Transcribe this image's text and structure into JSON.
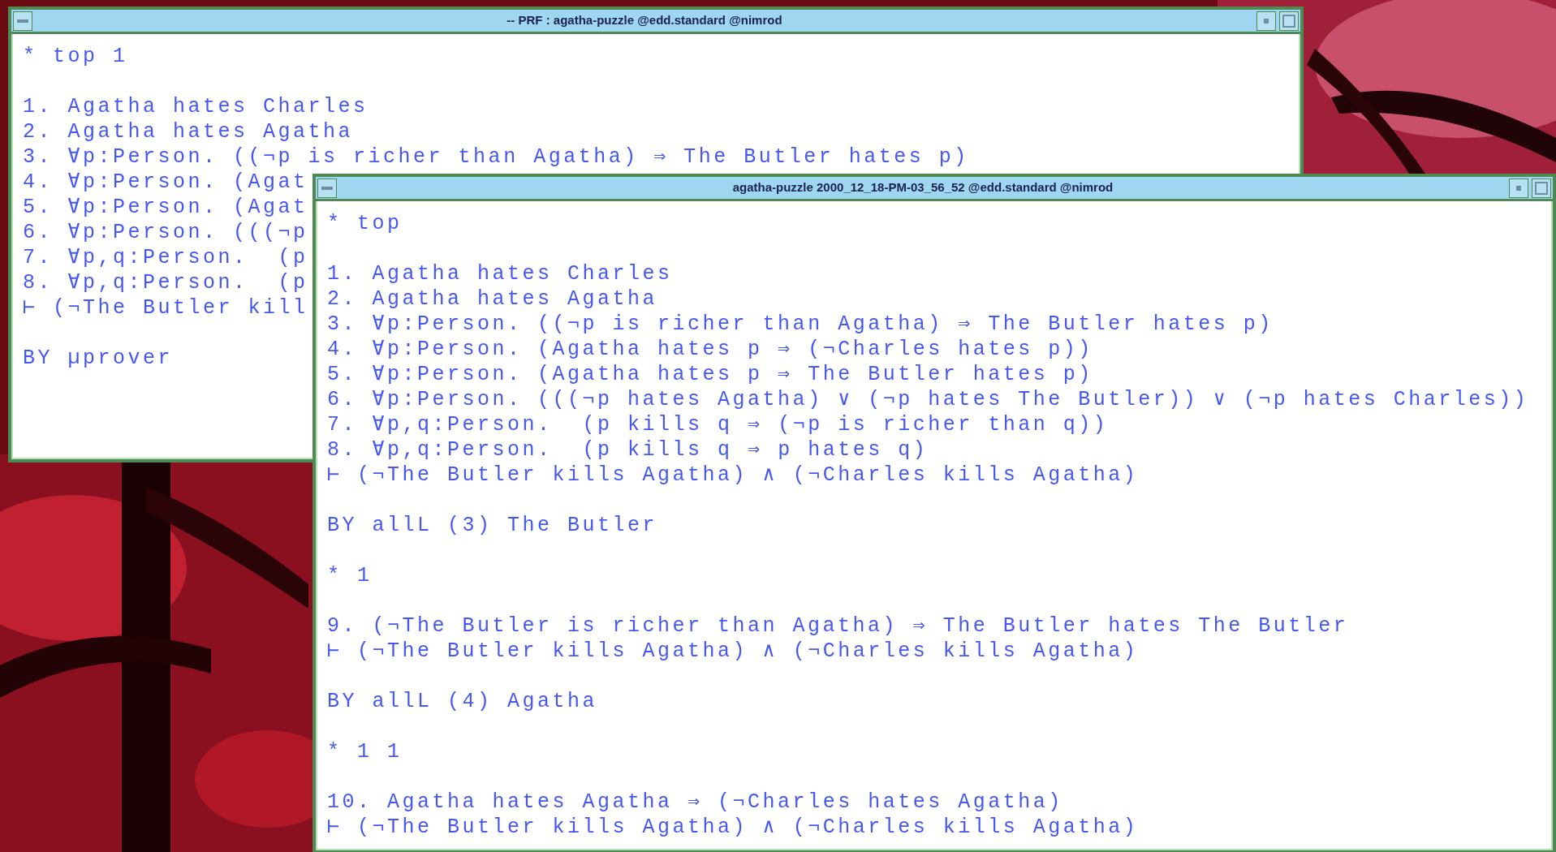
{
  "windows": [
    {
      "title": "-- PRF : agatha-puzzle @edd.standard @nimrod",
      "blocks": [
        [
          "* top 1"
        ],
        [
          "1. Agatha hates Charles",
          "2. Agatha hates Agatha",
          "3. ∀p:Person. ((¬p is richer than Agatha) ⇒ The Butler hates p)",
          "4. ∀p:Person. (Agat",
          "5. ∀p:Person. (Agat",
          "6. ∀p:Person. (((¬p",
          "7. ∀p,q:Person.  (p",
          "8. ∀p,q:Person.  (p",
          "⊢ (¬The Butler kill"
        ],
        [
          "BY µprover"
        ]
      ]
    },
    {
      "title": "agatha-puzzle 2000_12_18-PM-03_56_52 @edd.standard @nimrod",
      "blocks": [
        [
          "* top"
        ],
        [
          "1. Agatha hates Charles",
          "2. Agatha hates Agatha",
          "3. ∀p:Person. ((¬p is richer than Agatha) ⇒ The Butler hates p)",
          "4. ∀p:Person. (Agatha hates p ⇒ (¬Charles hates p))",
          "5. ∀p:Person. (Agatha hates p ⇒ The Butler hates p)",
          "6. ∀p:Person. (((¬p hates Agatha) ∨ (¬p hates The Butler)) ∨ (¬p hates Charles))",
          "7. ∀p,q:Person.  (p kills q ⇒ (¬p is richer than q))",
          "8. ∀p,q:Person.  (p kills q ⇒ p hates q)",
          "⊢ (¬The Butler kills Agatha) ∧ (¬Charles kills Agatha)"
        ],
        [
          "BY allL (3) The Butler"
        ],
        [
          "* 1"
        ],
        [
          "9. (¬The Butler is richer than Agatha) ⇒ The Butler hates The Butler",
          "⊢ (¬The Butler kills Agatha) ∧ (¬Charles kills Agatha)"
        ],
        [
          "BY allL (4) Agatha"
        ],
        [
          "* 1 1"
        ],
        [
          "10. Agatha hates Agatha ⇒ (¬Charles hates Agatha)",
          "⊢ (¬The Butler kills Agatha) ∧ (¬Charles kills Agatha)"
        ]
      ]
    }
  ]
}
